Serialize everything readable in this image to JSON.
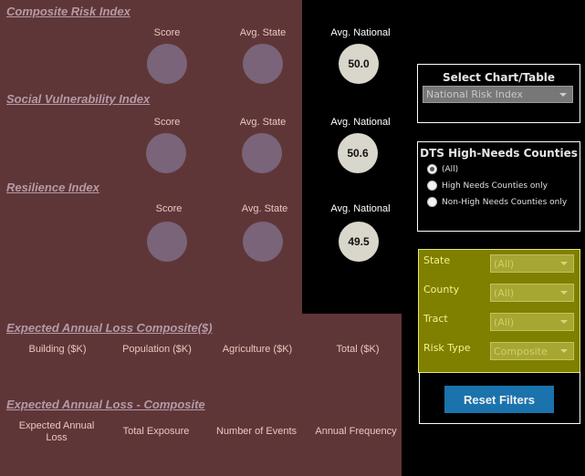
{
  "sections": {
    "composite": {
      "title": "Composite Risk Index",
      "labels": {
        "score": "Score",
        "state": "Avg. State",
        "national": "Avg. National"
      },
      "national_value": "50.0"
    },
    "social": {
      "title": "Social Vulnerability Index",
      "labels": {
        "score": "Score",
        "state": "Avg. State",
        "national": "Avg. National"
      },
      "national_value": "50.6"
    },
    "resilience": {
      "title": "Resilience Index",
      "labels": {
        "score": "Score",
        "state": "Avg. State",
        "national": "Avg. National"
      },
      "national_value": "49.5"
    }
  },
  "eal_composite_dollars": {
    "title": "Expected Annual Loss Composite($)",
    "headers": [
      "Building ($K)",
      "Population ($K)",
      "Agriculture ($K)",
      "Total ($K)"
    ]
  },
  "eal_composite": {
    "title": "Expected Annual Loss - Composite",
    "headers": [
      "Expected Annual Loss",
      "Total Exposure",
      "Number of Events",
      "Annual Frequency"
    ]
  },
  "select_chart": {
    "title": "Select Chart/Table",
    "selected": "National Risk Index"
  },
  "high_needs": {
    "title": "DTS High-Needs Counties",
    "options": [
      {
        "label": "(All)",
        "selected": true
      },
      {
        "label": "High Needs Counties only",
        "selected": false
      },
      {
        "label": "Non-High Needs Counties only",
        "selected": false
      }
    ]
  },
  "filters": {
    "state": {
      "label": "State",
      "value": "(All)"
    },
    "county": {
      "label": "County",
      "value": "(All)"
    },
    "tract": {
      "label": "Tract",
      "value": "(All)"
    },
    "risk_type": {
      "label": "Risk Type",
      "value": "Composite"
    }
  },
  "reset_button": {
    "label": "Reset Filters"
  },
  "colors": {
    "background_maroon": "#5f3637",
    "score_circle": "#7a6479",
    "national_circle": "#d9d6cb",
    "filter_panel": "#7f7f00",
    "reset_button": "#1a73ad"
  }
}
